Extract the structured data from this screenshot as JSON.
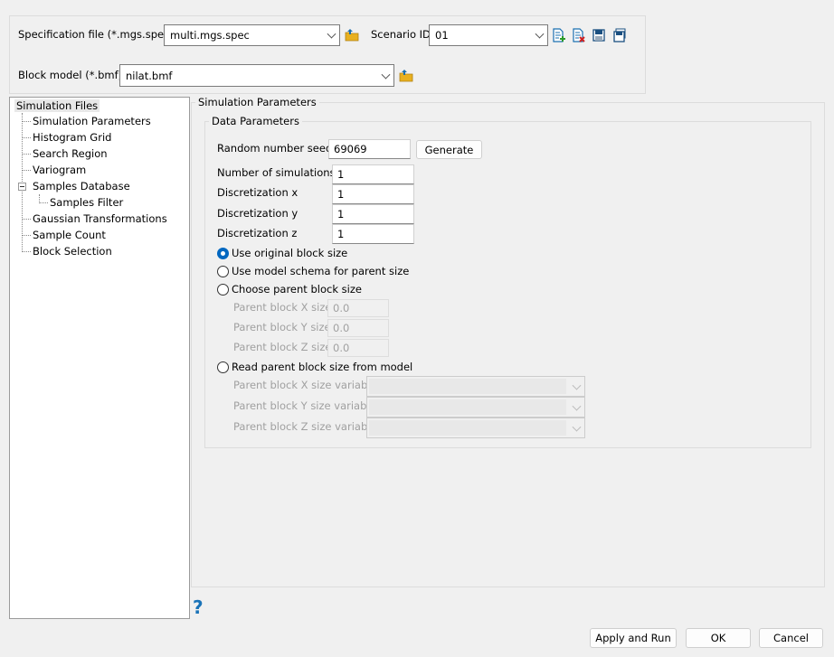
{
  "top": {
    "spec_label": "Specification file (*.mgs.spec)",
    "spec_value": "multi.mgs.spec",
    "scenario_label": "Scenario ID",
    "scenario_value": "01",
    "block_label": "Block model (*.bmf)",
    "block_value": "nilat.bmf",
    "icons": [
      "folder-open-icon",
      "add-scenario-icon",
      "delete-scenario-icon",
      "save-icon",
      "save-as-icon"
    ]
  },
  "tree": {
    "root": "Simulation Files",
    "items": [
      "Simulation Parameters",
      "Histogram Grid",
      "Search Region",
      "Variogram",
      "Samples Database",
      "Samples Filter",
      "Gaussian Transformations",
      "Sample Count",
      "Block Selection"
    ]
  },
  "main": {
    "group_title": "Simulation Parameters",
    "data_group_title": "Data Parameters",
    "seed_label": "Random number seed",
    "seed_value": "69069",
    "generate": "Generate",
    "nsim_label": "Number of simulations",
    "nsim_value": "1",
    "dx_label": "Discretization x",
    "dx_value": "1",
    "dy_label": "Discretization y",
    "dy_value": "1",
    "dz_label": "Discretization z",
    "dz_value": "1",
    "radios": [
      "Use original block size",
      "Use model schema for parent size",
      "Choose parent block size",
      "Read parent block size from model"
    ],
    "selected_radio": 0,
    "px_label": "Parent block X size",
    "px_value": "0.0",
    "py_label": "Parent block Y size",
    "py_value": "0.0",
    "pz_label": "Parent block Z size",
    "pz_value": "0.0",
    "vx_label": "Parent block X size variable",
    "vy_label": "Parent block Y size variable",
    "vz_label": "Parent block Z size variable"
  },
  "footer": {
    "help": "?",
    "apply": "Apply and Run",
    "ok": "OK",
    "cancel": "Cancel"
  },
  "colors": {
    "accent": "#0067c0",
    "help": "#1a73b8"
  }
}
